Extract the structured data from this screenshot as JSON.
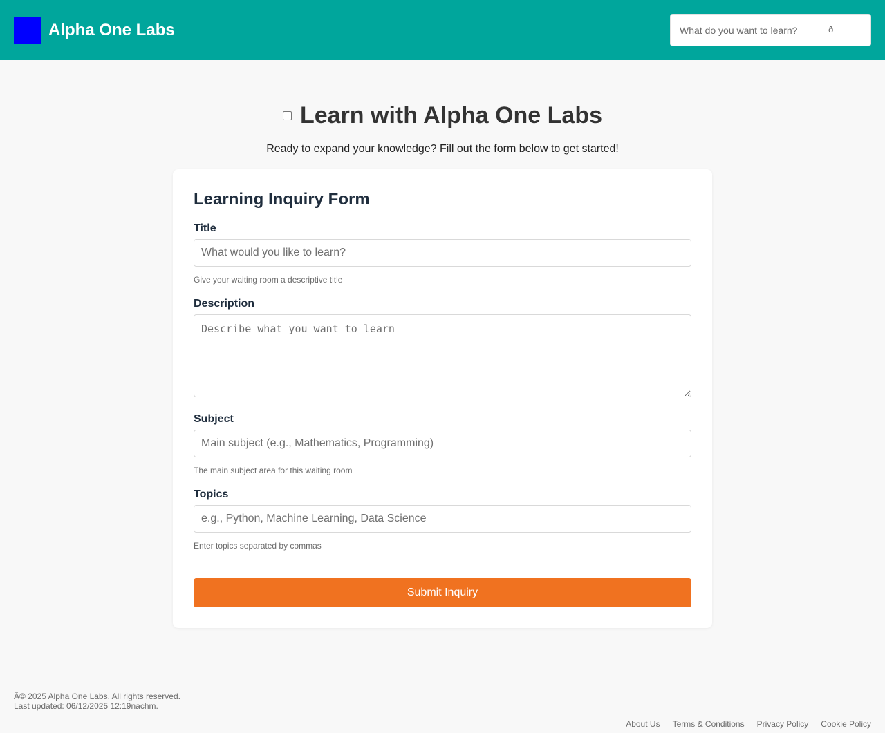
{
  "header": {
    "brand": "Alpha One Labs",
    "search_placeholder": "What do you want to learn?",
    "search_button_glyph": "ð",
    "logo_color": "#0000ff",
    "bg_color": "#00a69c"
  },
  "hero": {
    "title": "Learn with Alpha One Labs",
    "subtitle": "Ready to expand your knowledge? Fill out the form below to get started!"
  },
  "form": {
    "heading": "Learning Inquiry Form",
    "title_label": "Title",
    "title_placeholder": "What would you like to learn?",
    "title_help": "Give your waiting room a descriptive title",
    "description_label": "Description",
    "description_placeholder": "Describe what you want to learn",
    "subject_label": "Subject",
    "subject_placeholder": "Main subject (e.g., Mathematics, Programming)",
    "subject_help": "The main subject area for this waiting room",
    "topics_label": "Topics",
    "topics_placeholder": "e.g., Python, Machine Learning, Data Science",
    "topics_help": "Enter topics separated by commas",
    "submit_label": "Submit Inquiry",
    "submit_color": "#f07220"
  },
  "footer": {
    "copyright": "Â© 2025 Alpha One Labs. All rights reserved.",
    "updated": "Last updated: 06/12/2025 12:19nachm.",
    "links": [
      "About Us",
      "Terms & Conditions",
      "Privacy Policy",
      "Cookie Policy"
    ]
  }
}
